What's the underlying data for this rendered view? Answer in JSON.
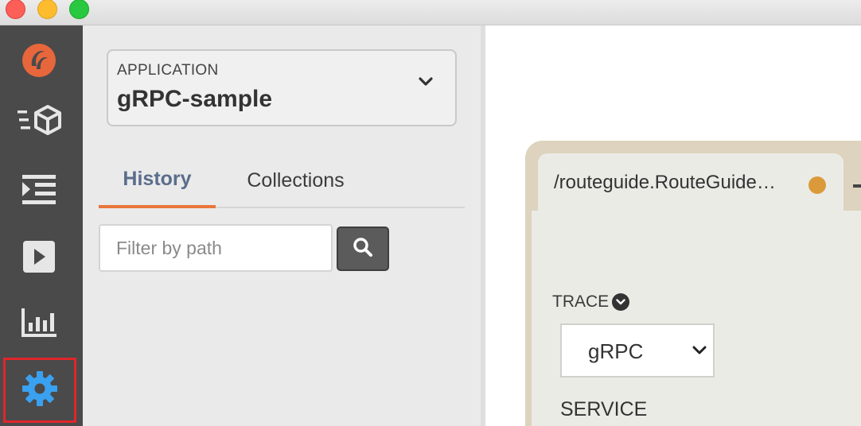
{
  "window": {
    "controls": [
      "close",
      "minimize",
      "maximize"
    ]
  },
  "rail": {
    "items": [
      {
        "icon": "logo-icon",
        "selected": false
      },
      {
        "icon": "box-list-icon",
        "selected": false
      },
      {
        "icon": "indent-list-icon",
        "selected": false
      },
      {
        "icon": "play-icon",
        "selected": false
      },
      {
        "icon": "bar-chart-icon",
        "selected": false
      },
      {
        "icon": "gear-icon",
        "selected": true
      }
    ],
    "colors": {
      "background": "#4a4a4a",
      "icon": "#e6e6e6",
      "logo": "#e8663b",
      "gear": "#3aa0f0",
      "highlight": "#e0262b"
    }
  },
  "sidebar": {
    "application": {
      "caption": "APPLICATION",
      "value": "gRPC-sample"
    },
    "tabs": [
      {
        "label": "History",
        "active": true
      },
      {
        "label": "Collections",
        "active": false
      }
    ],
    "filter": {
      "placeholder": "Filter by path",
      "value": ""
    }
  },
  "main": {
    "request_tab": {
      "title": "/routeguide.RouteGuide…",
      "status_color": "#db9a3a"
    },
    "trace": {
      "label": "TRACE",
      "selected": "gRPC"
    },
    "service": {
      "label": "SERVICE"
    }
  }
}
